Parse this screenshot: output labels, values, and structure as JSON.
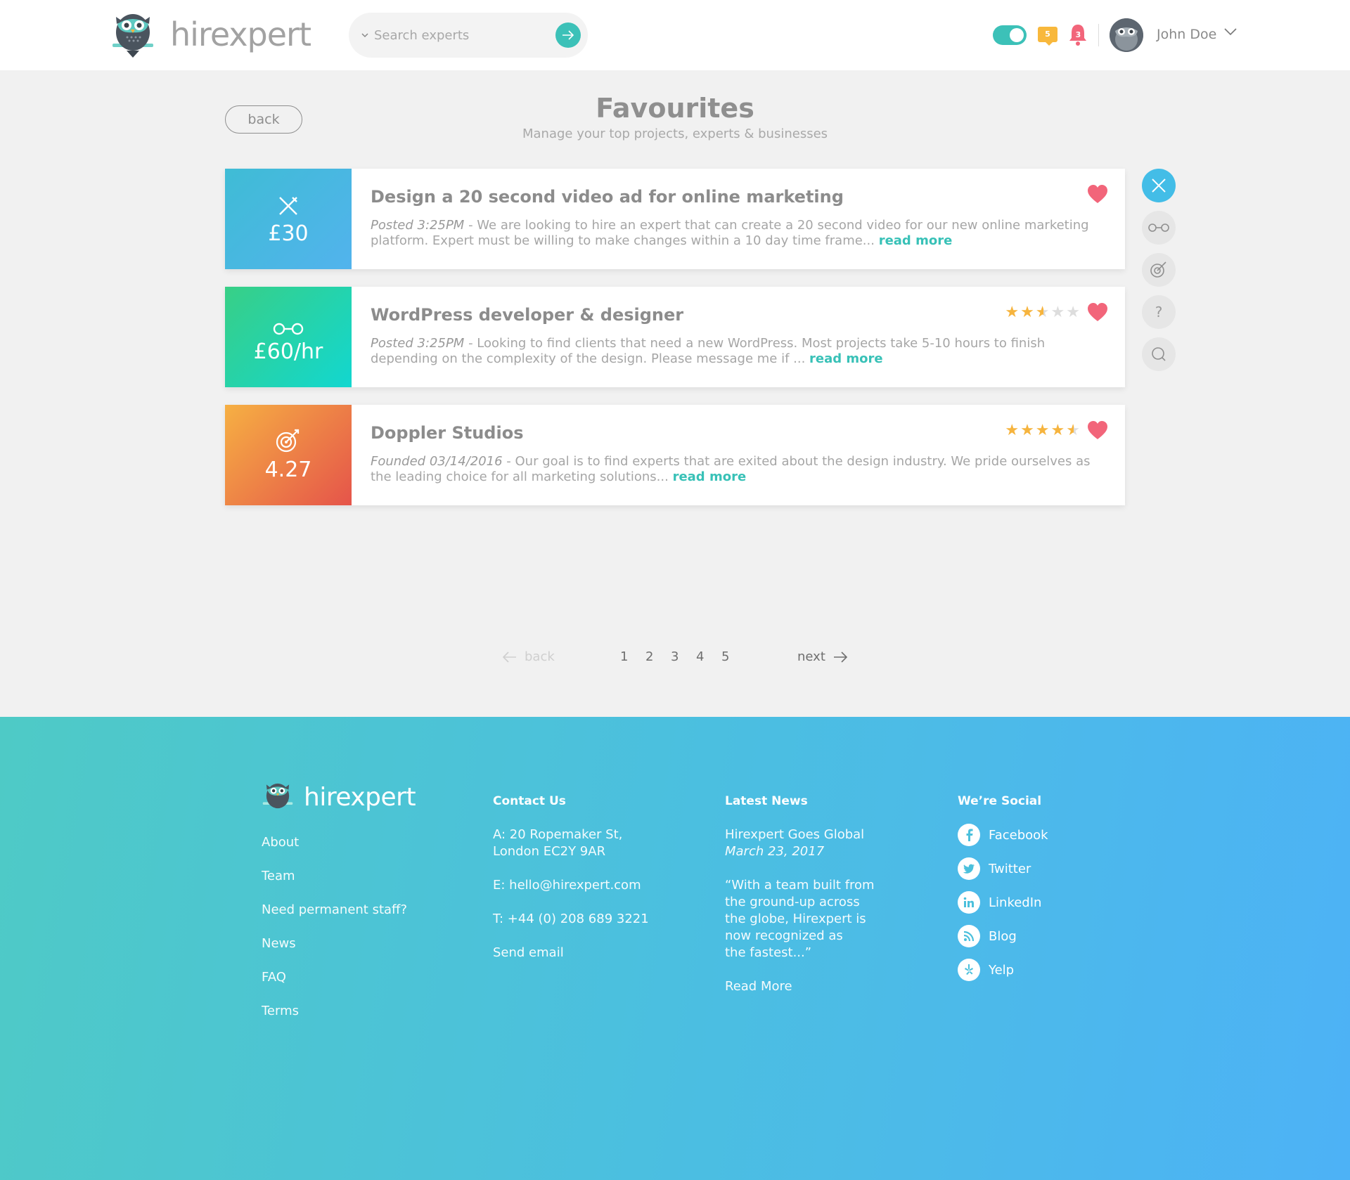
{
  "header": {
    "brand": "hirexpert",
    "search_placeholder": "Search experts",
    "messages_count": "5",
    "notifications_count": "3",
    "user_name": "John Doe"
  },
  "page": {
    "back_label": "back",
    "title": "Favourites",
    "subtitle": "Manage your top projects, experts & businesses"
  },
  "cards": [
    {
      "tile_value": "£30",
      "title": "Design a 20 second video ad for online marketing",
      "meta": "Posted 3:25PM",
      "text": " - We are looking to hire an expert that can create a 20 second video for our new online marketing platform. Expert must be willing to make changes within a 10 day time frame... ",
      "read_more": "read more"
    },
    {
      "tile_value": "£60/hr",
      "title": "WordPress developer & designer",
      "meta": "Posted 3:25PM",
      "text": " - Looking to find clients that need a new WordPress. Most projects take 5-10 hours to finish depending on the complexity of the design. Please message me if ... ",
      "read_more": "read more",
      "rating": 2.5
    },
    {
      "tile_value": "4.27",
      "title": "Doppler Studios",
      "meta": "Founded 03/14/2016",
      "text": " - Our goal is to find experts that are exited about the design industry. We pride ourselves as the leading choice for all marketing solutions... ",
      "read_more": "read more",
      "rating": 4.5
    }
  ],
  "rail": {
    "help_glyph": "?"
  },
  "pagination": {
    "back": "back",
    "pages": [
      "1",
      "2",
      "3",
      "4",
      "5"
    ],
    "next": "next"
  },
  "footer": {
    "brand": "hirexpert",
    "links": [
      "About",
      "Team",
      "Need permanent staff?",
      "News",
      "FAQ",
      "Terms"
    ],
    "contact": {
      "heading": "Contact Us",
      "address_line1": "A: 20 Ropemaker St,",
      "address_line2": "London EC2Y 9AR",
      "email": "E: hello@hirexpert.com",
      "phone": "T: +44 (0) 208 689 3221",
      "send": "Send email"
    },
    "news": {
      "heading": "Latest News",
      "headline": "Hirexpert Goes Global",
      "date": "March 23, 2017",
      "quote_lines": [
        "“With a team built from",
        "the ground-up across",
        "the globe, Hirexpert is",
        "now recognized as",
        "the fastest...”"
      ],
      "read_more": "Read More"
    },
    "social": {
      "heading": "We’re Social",
      "items": [
        "Facebook",
        "Twitter",
        "LinkedIn",
        "Blog",
        "Yelp"
      ]
    }
  },
  "colors": {
    "accent": "#3cc1b8",
    "heart": "#f2657a",
    "star": "#f6b43e"
  }
}
